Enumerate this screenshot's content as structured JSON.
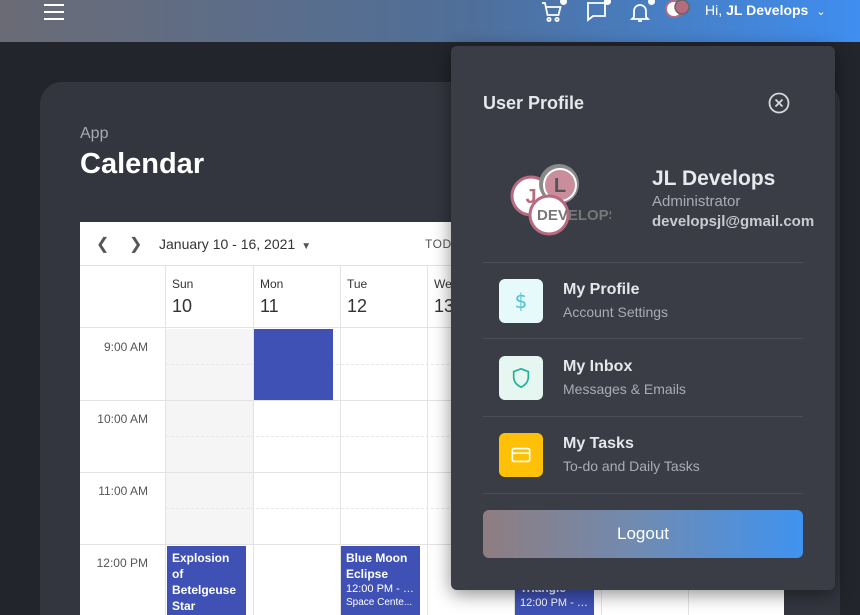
{
  "header": {
    "greeting": "Hi,",
    "user_name": "JL Develops",
    "avatar_text": "DEVELOPS"
  },
  "page": {
    "subtitle": "App",
    "title": "Calendar"
  },
  "calendar": {
    "range_label": "January 10 - 16, 2021",
    "today_label": "TODA",
    "days": [
      {
        "name": "Sun",
        "date": "10"
      },
      {
        "name": "Mon",
        "date": "11"
      },
      {
        "name": "Tue",
        "date": "12"
      },
      {
        "name": "We",
        "date": "13"
      }
    ],
    "times": [
      "9:00 AM",
      "10:00 AM",
      "11:00 AM",
      "12:00 PM"
    ],
    "events": [
      {
        "title": "Explosion of Betelgeuse Star",
        "time": "",
        "location": ""
      },
      {
        "title": "Blue Moon Eclipse",
        "time": "12:00 PM - 1...",
        "location": "Space Cente..."
      },
      {
        "title": "Triangle",
        "time": "12:00 PM - 1...",
        "location": ""
      }
    ],
    "event_color": "#3f51b5"
  },
  "profile": {
    "heading": "User Profile",
    "name": "JL Develops",
    "role": "Administrator",
    "email": "developsjl@gmail.com",
    "avatar_letters": [
      "J",
      "L"
    ],
    "avatar_text": "DEVELOPS",
    "items": [
      {
        "title": "My Profile",
        "subtitle": "Account Settings",
        "icon": "dollar-icon",
        "color": "#4dc3d1"
      },
      {
        "title": "My Inbox",
        "subtitle": "Messages & Emails",
        "icon": "shield-icon",
        "color": "#19b394"
      },
      {
        "title": "My Tasks",
        "subtitle": "To-do and Daily Tasks",
        "icon": "card-icon",
        "color": "#ffc107"
      }
    ],
    "logout_label": "Logout"
  }
}
